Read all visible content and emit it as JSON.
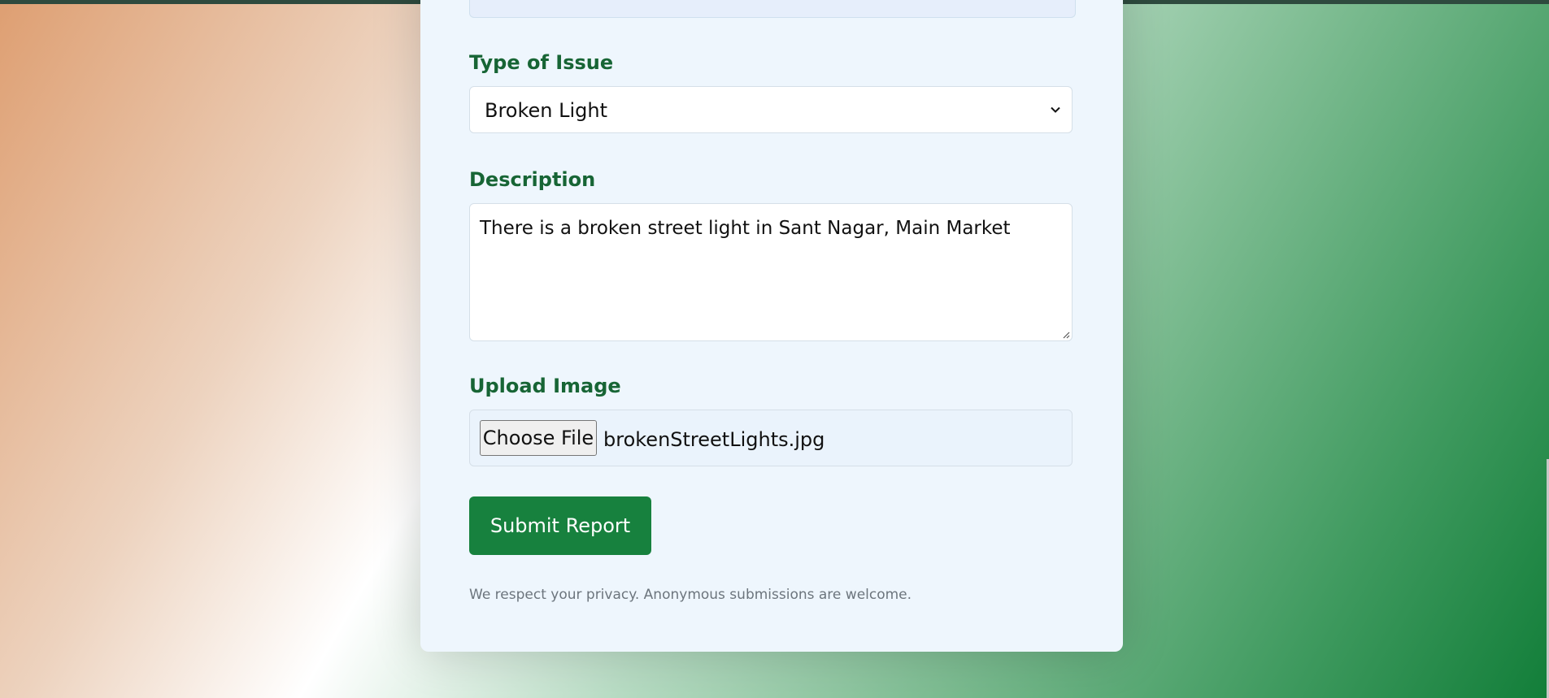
{
  "form": {
    "issue_type": {
      "label": "Type of Issue",
      "selected": "Broken Light"
    },
    "description": {
      "label": "Description",
      "value": "There is a broken street light in Sant Nagar, Main Market"
    },
    "upload": {
      "label": "Upload Image",
      "button_label": "Choose File",
      "file_name": "brokenStreetLights.jpg"
    },
    "submit_label": "Submit Report",
    "privacy_note": "We respect your privacy. Anonymous submissions are welcome."
  },
  "icons": {
    "select_chevron": "chevron-down-icon",
    "resize_handle": "resize-handle-icon"
  },
  "colors": {
    "label": "#176535",
    "submit_bg": "#17813e",
    "card_bg": "#eef6fd",
    "muted_text": "#6c757d"
  }
}
